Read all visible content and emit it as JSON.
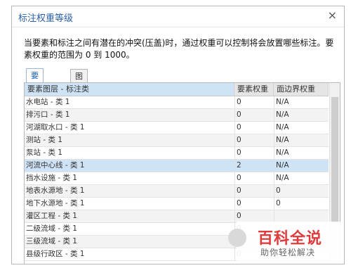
{
  "dialog": {
    "title": "标注权重等级",
    "close_glyph": "×",
    "description": "当要素和标注之间有潜在的冲突(压盖)时，通过权重可以控制将会放置哪些标注。要素权重的范围为 0 到 1000。"
  },
  "tabs": [
    {
      "label": "要素图层",
      "active": true
    },
    {
      "label": "图形图层",
      "active": false
    }
  ],
  "table": {
    "columns": [
      "要素图层 - 标注类",
      "要素权重",
      "面边界权重"
    ],
    "rows": [
      {
        "name": "水电站 - 类 1",
        "weight": "0",
        "boundary": "N/A"
      },
      {
        "name": "排污口 - 类 1",
        "weight": "0",
        "boundary": "N/A"
      },
      {
        "name": "河湖取水口 - 类 1",
        "weight": "0",
        "boundary": "N/A"
      },
      {
        "name": "测站 - 类 1",
        "weight": "0",
        "boundary": "N/A"
      },
      {
        "name": "泵站 - 类 1",
        "weight": "0",
        "boundary": "N/A"
      },
      {
        "name": "河流中心线 - 类 1",
        "weight": "2",
        "boundary": "N/A"
      },
      {
        "name": "挡水设施 - 类 1",
        "weight": "0",
        "boundary": "N/A"
      },
      {
        "name": "地表水源地 - 类 1",
        "weight": "0",
        "boundary": "0"
      },
      {
        "name": "地下水源地 - 类 1",
        "weight": "0",
        "boundary": "0"
      },
      {
        "name": "灌区工程 - 类 1",
        "weight": "0",
        "boundary": ""
      },
      {
        "name": "二级流域 - 类 1",
        "weight": "0",
        "boundary": ""
      },
      {
        "name": "三级流域 - 类 1",
        "weight": "0",
        "boundary": ""
      },
      {
        "name": "县级行政区 - 类 1",
        "weight": "0",
        "boundary": ""
      }
    ],
    "selected_row": 5
  },
  "watermark": {
    "logo_text": "百科全说",
    "sub_text": "助你轻松解决"
  },
  "colors": {
    "title": "#2b5fa8",
    "selection": "#cfe3f7",
    "watermark_red": "#e03a3a"
  }
}
